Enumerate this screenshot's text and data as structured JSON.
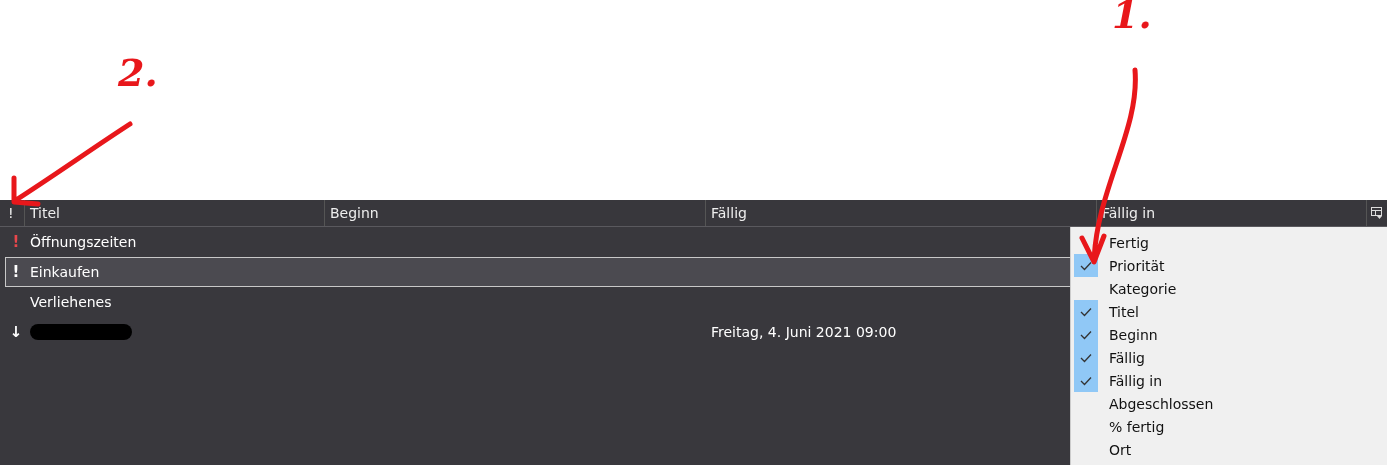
{
  "annotations": [
    {
      "label": "1."
    },
    {
      "label": "2."
    }
  ],
  "table": {
    "columns": [
      {
        "label": "!"
      },
      {
        "label": "Titel"
      },
      {
        "label": "Beginn"
      },
      {
        "label": "Fällig"
      },
      {
        "label": "Fällig in"
      }
    ],
    "rows": [
      {
        "kind": "high",
        "priority_icon": "!",
        "title": "Öffnungszeiten",
        "due": "",
        "selected": false
      },
      {
        "kind": "normal",
        "priority_icon": "!",
        "title": "Einkaufen",
        "due": "",
        "selected": true
      },
      {
        "kind": "none",
        "title": "Verliehenes",
        "due": "",
        "selected": false
      },
      {
        "kind": "low",
        "priority_icon": "↓",
        "redacted": true,
        "due": "Freitag, 4. Juni 2021 09:00",
        "selected": false
      }
    ]
  },
  "column_menu": {
    "items": [
      {
        "label": "Fertig",
        "checked": false
      },
      {
        "label": "Priorität",
        "checked": true
      },
      {
        "label": "Kategorie",
        "checked": false
      },
      {
        "label": "Titel",
        "checked": true
      },
      {
        "label": "Beginn",
        "checked": true
      },
      {
        "label": "Fällig",
        "checked": true
      },
      {
        "label": "Fällig in",
        "checked": true
      },
      {
        "label": "Abgeschlossen",
        "checked": false
      },
      {
        "label": "% fertig",
        "checked": false
      },
      {
        "label": "Ort",
        "checked": false
      }
    ]
  }
}
